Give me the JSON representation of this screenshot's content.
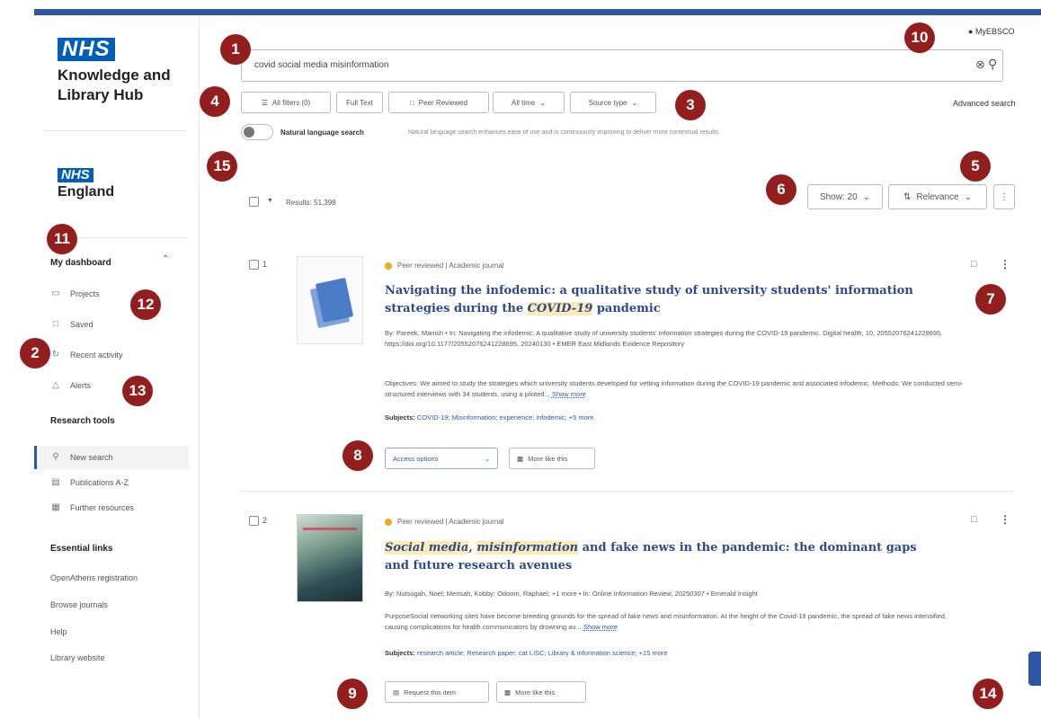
{
  "app": {
    "nhs_logo": "NHS",
    "hub_title": "Knowledge and Library Hub",
    "org_logo": "NHS",
    "org_name": "England"
  },
  "header": {
    "account_label": "MyEBSCO"
  },
  "sidebar": {
    "dashboard_heading": "My dashboard",
    "dashboard_items": [
      {
        "label": "Projects",
        "icon": "folder-icon"
      },
      {
        "label": "Saved",
        "icon": "bookmark-icon"
      },
      {
        "label": "Recent activity",
        "icon": "history-icon"
      },
      {
        "label": "Alerts",
        "icon": "bell-icon"
      }
    ],
    "research_heading": "Research tools",
    "research_items": [
      {
        "label": "New search",
        "icon": "search-icon"
      },
      {
        "label": "Publications A-Z",
        "icon": "document-icon"
      },
      {
        "label": "Further resources",
        "icon": "grid-icon"
      }
    ],
    "essential_heading": "Essential links",
    "essential_links": [
      "OpenAthens registration",
      "Browse journals",
      "Help",
      "Library website"
    ]
  },
  "search": {
    "query": "covid social media misinformation",
    "advanced_label": "Advanced search"
  },
  "filters": {
    "all_filters": "All filters (0)",
    "full_text": "Full Text",
    "peer_reviewed": "Peer Reviewed",
    "all_time": "All time",
    "source_type": "Source type"
  },
  "natural_language": {
    "label": "Natural language search",
    "description": "Natural language search enhances ease of use and is continuously improving to deliver more contextual results."
  },
  "results_bar": {
    "count": "Results: 51,398",
    "show": "Show: 20",
    "sort": "Relevance"
  },
  "results": [
    {
      "number": "1",
      "type": "Peer reviewed | Academic journal",
      "title_before": "Navigating the infodemic: a qualitative study of university students' information strategies during the ",
      "title_hl": "COVID-19",
      "title_after": " pandemic",
      "byline": "By: Pareek, Manish • In: Navigating the infodemic: A qualitative study of university students' information strategies during the COVID-19 pandemic. Digital health, 10, 20552076241228695. https://doi.org/10.1177/20552076241228695, 20240130 • EMER East Midlands Evidence Repository",
      "abstract": "Objectives: We aimed to study the strategies which university students developed for vetting information during the COVID-19 pandemic and associated infodemic. Methods: We conducted semi-structured interviews with 34 students, using a piloted...",
      "show_more": "Show more",
      "subjects_label": "Subjects:",
      "subjects": "COVID-19; Misinformation; experience; infodemic;",
      "subjects_more": "+5 more",
      "primary_button": "Access options",
      "secondary_button": "More like this"
    },
    {
      "number": "2",
      "type": "Peer reviewed | Academic journal",
      "title_hl_1": "Social media",
      "title_sep": ", ",
      "title_hl_2": "misinformation",
      "title_after": " and fake news in the pandemic: the dominant gaps and future research avenues",
      "byline": "By: Nutsugah, Noel; Mensah, Kobby; Odoom, Raphael; +1 more • In: Online Information Review, 20250307 • Emerald Insight",
      "abstract": "PurposeSocial networking sites have become breeding grounds for the spread of fake news and misinformation. At the height of the Covid-19 pandemic, the spread of fake news intensified, causing complications for health communicators by drowning au...",
      "show_more": "Show more",
      "subjects_label": "Subjects:",
      "subjects": "research article; Research paper; cat LISC; Library & information science;",
      "subjects_more": "+15 more",
      "primary_button": "Request this item",
      "secondary_button": "More like this"
    }
  ],
  "markers": [
    "1",
    "2",
    "3",
    "4",
    "5",
    "6",
    "7",
    "8",
    "9",
    "10",
    "11",
    "12",
    "13",
    "14",
    "15"
  ]
}
